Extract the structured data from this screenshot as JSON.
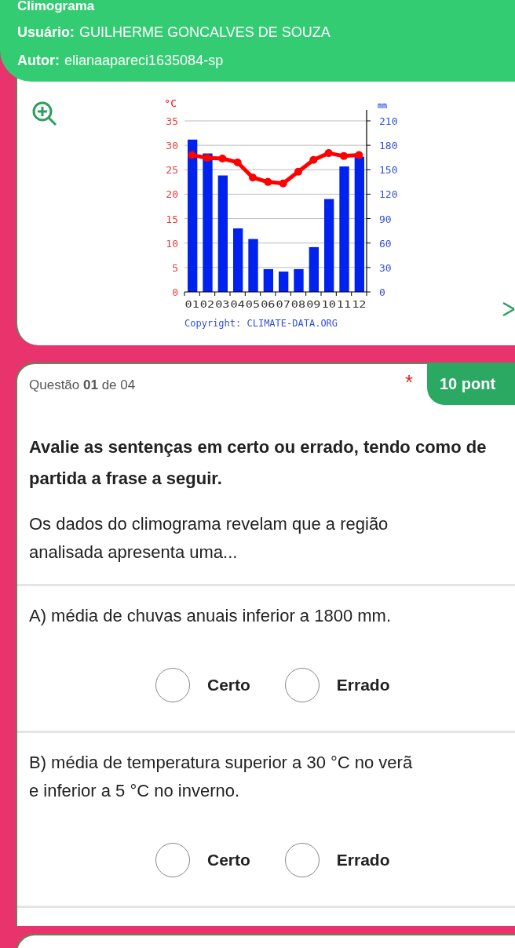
{
  "header": {
    "title": "Climograma",
    "user_label": "Usuário:",
    "user": "GUILHERME GONCALVES DE SOUZA",
    "author_label": "Autor:",
    "author": "elianaapareci1635084-sp"
  },
  "climate_chart": {
    "chart_data": {
      "type": "bar",
      "categories": [
        "01",
        "02",
        "03",
        "04",
        "05",
        "06",
        "07",
        "08",
        "09",
        "10",
        "11",
        "12"
      ],
      "series": [
        {
          "name": "mm",
          "type": "bar",
          "axis": "y2",
          "color": "#0022ee",
          "values": [
            187,
            170,
            143,
            78,
            65,
            28,
            25,
            28,
            55,
            114,
            154,
            166
          ]
        },
        {
          "name": "°C",
          "type": "line",
          "axis": "y",
          "marker": true,
          "color": "#ff0000",
          "values": [
            28,
            27.4,
            27.3,
            26.5,
            23.4,
            22.5,
            22.2,
            24.6,
            27,
            28.4,
            27.8,
            28
          ]
        }
      ],
      "grid": true,
      "ylim": [
        0,
        35
      ],
      "yticks": [
        0,
        5,
        10,
        15,
        20,
        25,
        30,
        35
      ],
      "y2lim": [
        0,
        210
      ],
      "y2ticks": [
        0,
        30,
        60,
        90,
        120,
        150,
        180,
        210
      ]
    },
    "credit": "Copyright: CLIMATE-DATA.ORG"
  },
  "question": {
    "counter": "Questão **01** de 04",
    "required_mark": "*",
    "points": "10 pont",
    "prompt": "Avalie as sentenças em certo ou errado, tendo como de partida a frase a seguir.",
    "statement": "Os dados do climograma revelam que a região analisada apresenta uma...",
    "items": [
      {
        "text": "A) média de chuvas anuais inferior a 1800 mm.",
        "options": [
          {
            "label": "Certo",
            "selected": false
          },
          {
            "label": "Errado",
            "selected": false
          }
        ]
      },
      {
        "text": "B) média de temperatura superior a 30 °C no verã\ne inferior a 5 °C no inverno.",
        "options": [
          {
            "label": "Certo",
            "selected": false
          },
          {
            "label": "Errado",
            "selected": false
          }
        ]
      }
    ]
  }
}
